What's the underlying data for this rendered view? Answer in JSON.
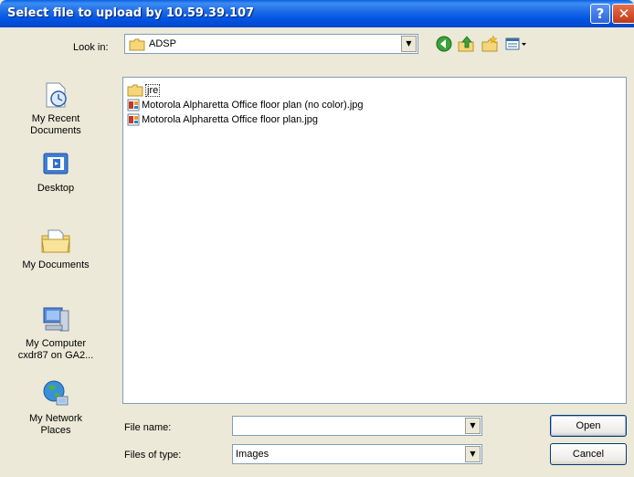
{
  "window": {
    "title": "Select file to upload by 10.59.39.107",
    "help_label": "?",
    "close_label": "✕"
  },
  "toolbar": {
    "lookin_label": "Look in:",
    "lookin_value": "ADSP",
    "icons": [
      "back-icon",
      "up-folder-icon",
      "new-folder-icon",
      "view-menu-icon"
    ]
  },
  "places": [
    {
      "name": "my-recent-documents",
      "label": "My Recent\nDocuments"
    },
    {
      "name": "desktop",
      "label": "Desktop"
    },
    {
      "name": "my-documents",
      "label": "My Documents"
    },
    {
      "name": "my-computer",
      "label": "My Computer\ncxdr87 on GA2..."
    },
    {
      "name": "my-network-places",
      "label": "My Network\nPlaces"
    }
  ],
  "files": [
    {
      "type": "folder",
      "name": "jre"
    },
    {
      "type": "image",
      "name": "Motorola Alpharetta Office floor plan (no color).jpg"
    },
    {
      "type": "image",
      "name": "Motorola Alpharetta Office floor plan.jpg"
    }
  ],
  "form": {
    "filename_label": "File name:",
    "filename_value": "",
    "filetype_label": "Files of type:",
    "filetype_value": "Images",
    "open_label": "Open",
    "cancel_label": "Cancel"
  },
  "colors": {
    "titlebar": "#0054E3",
    "dialog_bg": "#ECE9D8",
    "field_border": "#7F9DB9"
  }
}
